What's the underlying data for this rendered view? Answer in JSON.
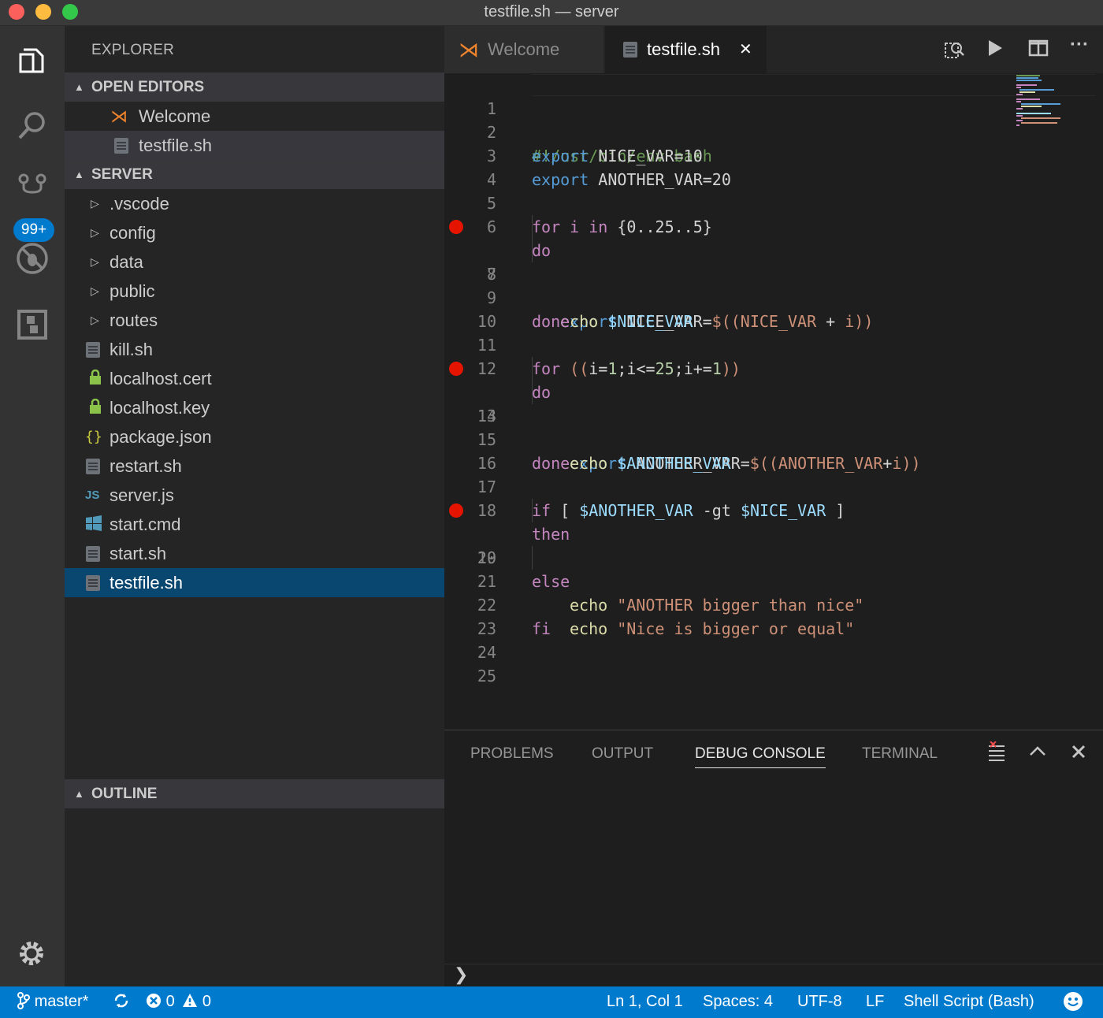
{
  "window": {
    "title": "testfile.sh — server"
  },
  "activity_bar": {
    "badge": "99+"
  },
  "sidebar": {
    "title": "EXPLORER",
    "open_editors": {
      "header": "OPEN EDITORS",
      "items": [
        {
          "label": "Welcome",
          "icon": "vscode-icon"
        },
        {
          "label": "testfile.sh",
          "icon": "file-icon"
        }
      ]
    },
    "server": {
      "header": "SERVER",
      "folders": [
        ".vscode",
        "config",
        "data",
        "public",
        "routes"
      ],
      "files": [
        {
          "label": "kill.sh",
          "icon": "file-icon"
        },
        {
          "label": "localhost.cert",
          "icon": "lock-icon"
        },
        {
          "label": "localhost.key",
          "icon": "lock-icon"
        },
        {
          "label": "package.json",
          "icon": "json-icon"
        },
        {
          "label": "restart.sh",
          "icon": "file-icon"
        },
        {
          "label": "server.js",
          "icon": "js-icon"
        },
        {
          "label": "start.cmd",
          "icon": "windows-icon"
        },
        {
          "label": "start.sh",
          "icon": "file-icon"
        },
        {
          "label": "testfile.sh",
          "icon": "file-icon"
        }
      ]
    },
    "outline": {
      "header": "OUTLINE"
    }
  },
  "editor": {
    "tabs": [
      {
        "label": "Welcome",
        "active": false
      },
      {
        "label": "testfile.sh",
        "active": true
      }
    ],
    "close_glyph": "✕",
    "breakpoint_lines": [
      7,
      13,
      19
    ],
    "line_numbers": [
      "1",
      "2",
      "3",
      "4",
      "5",
      "6",
      "7",
      "8",
      "9",
      "10",
      "11",
      "12",
      "13",
      "14",
      "15",
      "16",
      "17",
      "18",
      "19",
      "20",
      "21",
      "22",
      "23",
      "24",
      "25"
    ],
    "lines": {
      "l1": "#!/usr/bin/env bash",
      "l2_kw": "export",
      "l2_rest": " NICE_VAR=10",
      "l3_kw": "export",
      "l3_rest": " ANOTHER_VAR=20",
      "l5_for": "for",
      "l5_i": " i ",
      "l5_in": "in",
      "l5_rest": " {0..25..5}",
      "l6": "do",
      "l7_kw": "export",
      "l7_a": " NICE_VAR=",
      "l7_b": "$((NICE_VAR",
      "l7_c": " + ",
      "l7_d": "i))",
      "l8_fn": "echo",
      "l8_var": " $NICE_VAR",
      "l9": "done",
      "l11_for": "for",
      "l11_a": " ((",
      "l11_b": "i=",
      "l11_c": "1",
      "l11_d": ";i<=",
      "l11_e": "25",
      "l11_f": ";i+=",
      "l11_g": "1",
      "l11_h": "))",
      "l12": "do",
      "l13_kw": "export",
      "l13_a": " ANOTHER_VAR=",
      "l13_b": "$((ANOTHER_VAR",
      "l13_c": "+",
      "l13_d": "i))",
      "l14_fn": "echo",
      "l14_var": " $ANOTHER_VAR",
      "l15": "done",
      "l17_if": "if",
      "l17_a": " [ ",
      "l17_v1": "$ANOTHER_VAR",
      "l17_b": " -gt ",
      "l17_v2": "$NICE_VAR",
      "l17_c": " ]",
      "l18": "then",
      "l19_fn": "echo",
      "l19_str": " \"ANOTHER bigger than nice\"",
      "l20": "else",
      "l21_fn": "echo",
      "l21_str": " \"Nice is bigger or equal\"",
      "l22": "fi"
    }
  },
  "panel": {
    "tabs": [
      "PROBLEMS",
      "OUTPUT",
      "DEBUG CONSOLE",
      "TERMINAL"
    ],
    "active_tab": "DEBUG CONSOLE",
    "prompt": "❯"
  },
  "status_bar": {
    "branch": "master*",
    "errors": "0",
    "warnings": "0",
    "position": "Ln 1, Col 1",
    "spaces": "Spaces: 4",
    "encoding": "UTF-8",
    "eol": "LF",
    "language": "Shell Script (Bash)"
  },
  "colors": {
    "accent": "#007acc",
    "selection": "#094771",
    "breakpoint": "#e51400"
  }
}
